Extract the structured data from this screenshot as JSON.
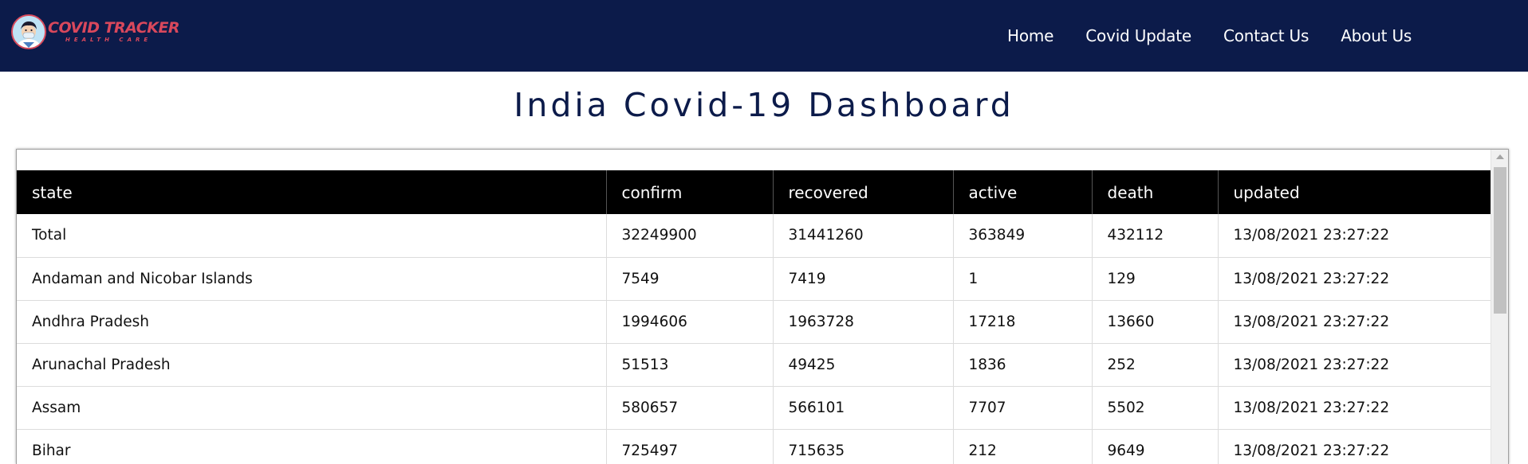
{
  "brand": {
    "title": "COVID TRACKER",
    "subtitle": "HEALTH CARE"
  },
  "nav": {
    "items": [
      {
        "label": "Home"
      },
      {
        "label": "Covid Update"
      },
      {
        "label": "Contact Us"
      },
      {
        "label": "About Us"
      }
    ]
  },
  "page": {
    "title": "India Covid-19 Dashboard"
  },
  "table": {
    "columns": [
      "state",
      "confirm",
      "recovered",
      "active",
      "death",
      "updated"
    ],
    "rows": [
      [
        "Total",
        "32249900",
        "31441260",
        "363849",
        "432112",
        "13/08/2021 23:27:22"
      ],
      [
        "Andaman and Nicobar Islands",
        "7549",
        "7419",
        "1",
        "129",
        "13/08/2021 23:27:22"
      ],
      [
        "Andhra Pradesh",
        "1994606",
        "1963728",
        "17218",
        "13660",
        "13/08/2021 23:27:22"
      ],
      [
        "Arunachal Pradesh",
        "51513",
        "49425",
        "1836",
        "252",
        "13/08/2021 23:27:22"
      ],
      [
        "Assam",
        "580657",
        "566101",
        "7707",
        "5502",
        "13/08/2021 23:27:22"
      ],
      [
        "Bihar",
        "725497",
        "715635",
        "212",
        "9649",
        "13/08/2021 23:27:22"
      ]
    ]
  },
  "colors": {
    "navbar_bg": "#0c1b4a",
    "brand_red": "#d9485c",
    "header_bg": "#000000"
  },
  "icons": {
    "logo": "doctor-avatar-icon",
    "scroll_up": "triangle-up-icon"
  }
}
